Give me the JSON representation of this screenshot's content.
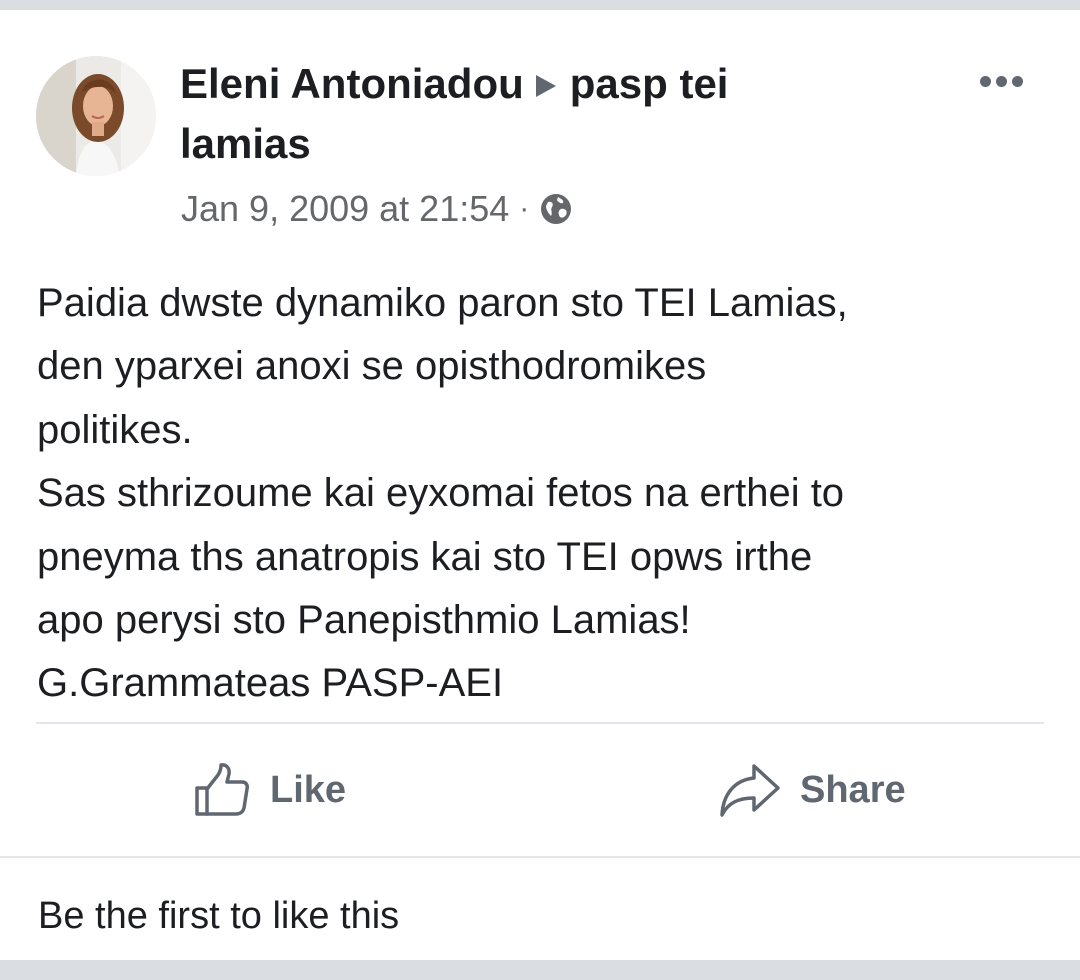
{
  "post": {
    "author": "Eleni Antoniadou",
    "target_group_line1": "pasp tei",
    "target_group_line2": "lamias",
    "timestamp": "Jan 9, 2009 at 21:54",
    "separator": "·",
    "privacy_icon": "globe-icon",
    "menu_icon": "more-horizontal-icon",
    "body_lines": [
      "Paidia dwste dynamiko paron sto TEI Lamias,",
      "den yparxei anoxi se opisthodromikes",
      "politikes.",
      "Sas sthrizoume kai eyxomai fetos na erthei to",
      "pneyma ths anatropis kai sto TEI opws irthe",
      "apo perysi sto Panepisthmio Lamias!",
      "G.Grammateas PASP-AEI"
    ]
  },
  "actions": {
    "like_label": "Like",
    "share_label": "Share"
  },
  "footer": {
    "reactions_text": "Be the first to like this"
  },
  "colors": {
    "background": "#dadde1",
    "card": "#ffffff",
    "text": "#1c1e21",
    "secondary_text": "#65676b",
    "icon": "#606770"
  }
}
